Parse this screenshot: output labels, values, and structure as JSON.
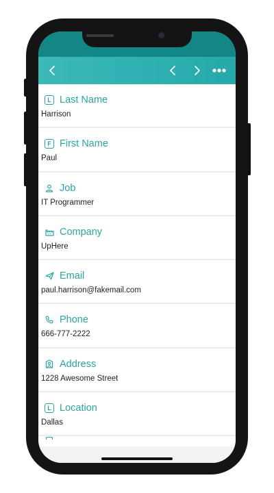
{
  "nav": {
    "back_icon": "chevron-left-icon",
    "prev_icon": "chevron-left-icon",
    "next_icon": "chevron-right-icon",
    "more_icon": "more-horizontal-icon"
  },
  "fields": [
    {
      "icon": "letter-l-badge-icon",
      "badge": "L",
      "label": "Last Name",
      "value": "Harrison"
    },
    {
      "icon": "letter-f-badge-icon",
      "badge": "F",
      "label": "First Name",
      "value": "Paul"
    },
    {
      "icon": "person-icon",
      "label": "Job",
      "value": "IT Programmer"
    },
    {
      "icon": "factory-icon",
      "label": "Company",
      "value": "UpHere"
    },
    {
      "icon": "send-icon",
      "label": "Email",
      "value": "paul.harrison@fakemail.com"
    },
    {
      "icon": "phone-icon",
      "label": "Phone",
      "value": "666-777-2222"
    },
    {
      "icon": "address-person-icon",
      "label": "Address",
      "value": "1228 Awesome Street"
    },
    {
      "icon": "letter-l-badge-icon",
      "badge": "L",
      "label": "Location",
      "value": "Dallas"
    }
  ],
  "colors": {
    "accent": "#2aa3a3",
    "navbar": "#3cb9b9",
    "status_band": "#138787",
    "frame": "#141414"
  }
}
